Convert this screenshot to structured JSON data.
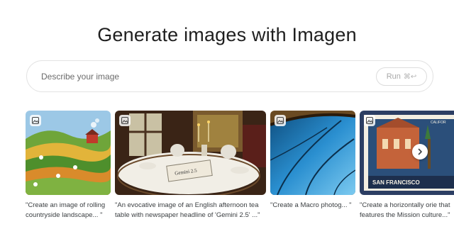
{
  "title": "Generate images with Imagen",
  "prompt": {
    "placeholder": "Describe your image",
    "run_label": "Run",
    "shortcut": "⌘↩"
  },
  "gallery": {
    "items": [
      {
        "caption": "\"Create an image of rolling countryside landscape... \"",
        "icon": "image-icon"
      },
      {
        "caption": "\"An evocative image of an English afternoon tea table with newspaper headline of 'Gemini 2.5' ...\"",
        "icon": "image-icon"
      },
      {
        "caption": "\"Create a Macro photog... \"",
        "icon": "image-icon"
      },
      {
        "caption": "\"Create a horizontally orie that features the Mission culture...\"",
        "icon": "image-icon"
      }
    ],
    "stamp_text": "SAN FRANCISCO",
    "stamp_subtext": "CALIFOR",
    "newspaper_text": "Gemini 2.5",
    "next_icon": "chevron-right-icon"
  }
}
